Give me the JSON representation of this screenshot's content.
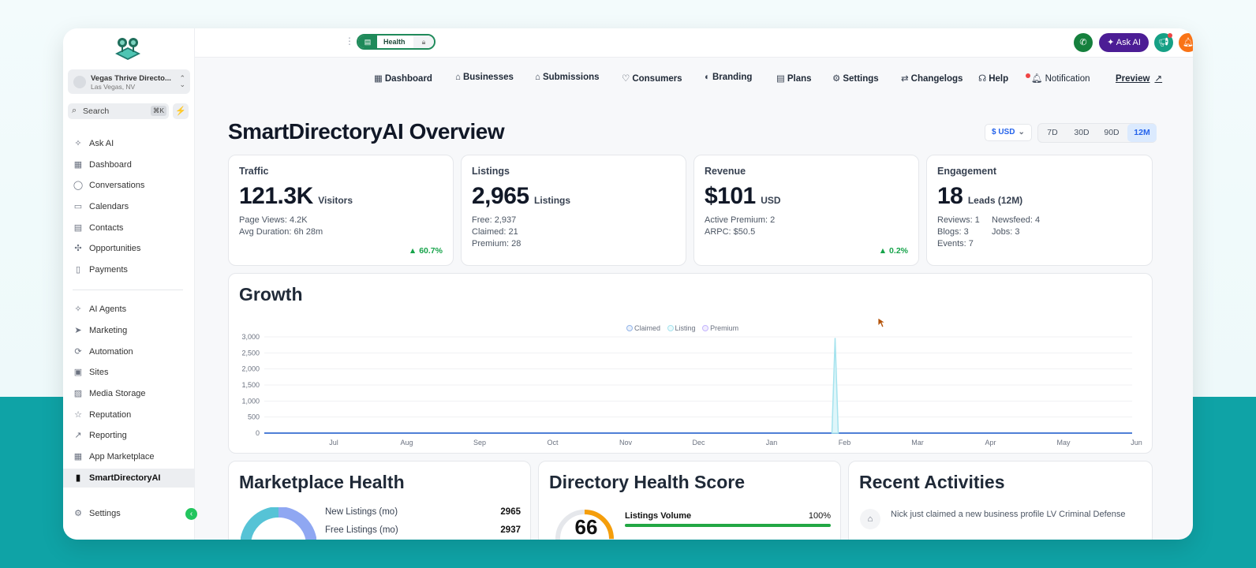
{
  "sidebar": {
    "location": {
      "name": "Vegas Thrive Directo...",
      "city": "Las Vegas, NV"
    },
    "search": {
      "label": "Search",
      "shortcut": "⌘K"
    },
    "items": [
      {
        "label": "Ask AI",
        "icon": "sparkle-icon"
      },
      {
        "label": "Dashboard",
        "icon": "grid-icon"
      },
      {
        "label": "Conversations",
        "icon": "chat-icon"
      },
      {
        "label": "Calendars",
        "icon": "calendar-icon"
      },
      {
        "label": "Contacts",
        "icon": "contacts-icon"
      },
      {
        "label": "Opportunities",
        "icon": "opportunities-icon"
      },
      {
        "label": "Payments",
        "icon": "receipt-icon"
      },
      {
        "label": "AI Agents",
        "icon": "sparkle-icon"
      },
      {
        "label": "Marketing",
        "icon": "send-icon"
      },
      {
        "label": "Automation",
        "icon": "automation-icon"
      },
      {
        "label": "Sites",
        "icon": "sites-icon"
      },
      {
        "label": "Media Storage",
        "icon": "image-icon"
      },
      {
        "label": "Reputation",
        "icon": "star-icon"
      },
      {
        "label": "Reporting",
        "icon": "trend-icon"
      },
      {
        "label": "App Marketplace",
        "icon": "apps-icon"
      },
      {
        "label": "SmartDirectoryAI",
        "icon": "book-icon"
      },
      {
        "label": "Settings",
        "icon": "gear-icon"
      }
    ]
  },
  "topbar": {
    "health_label": "Health",
    "ask_ai_label": "Ask AI",
    "help_glyph": "?",
    "avatar_initials": "TG"
  },
  "nav": {
    "links": [
      "Dashboard",
      "Businesses",
      "Submissions",
      "Consumers",
      "Branding",
      "Plans",
      "Settings",
      "Changelogs",
      "Help",
      "Notification",
      "Preview"
    ]
  },
  "header": {
    "title": "SmartDirectoryAI Overview",
    "currency": "$ USD",
    "ranges": [
      "7D",
      "30D",
      "90D",
      "12M"
    ],
    "active_range": "12M"
  },
  "stats": {
    "traffic": {
      "title": "Traffic",
      "value": "121.3K",
      "unit": "Visitors",
      "lines": [
        "Page Views: 4.2K",
        "Avg Duration: 6h 28m"
      ],
      "delta": "▲ 60.7%"
    },
    "listings": {
      "title": "Listings",
      "value": "2,965",
      "unit": "Listings",
      "lines": [
        "Free: 2,937",
        "Claimed: 21",
        "Premium: 28"
      ]
    },
    "revenue": {
      "title": "Revenue",
      "value": "$101",
      "unit": "USD",
      "lines": [
        "Active Premium: 2",
        "ARPC: $50.5"
      ],
      "delta": "▲ 0.2%"
    },
    "engagement": {
      "title": "Engagement",
      "value": "18",
      "unit": "Leads (12M)",
      "col1": [
        "Reviews: 1",
        "Blogs: 3",
        "Events: 7"
      ],
      "col2": [
        "Newsfeed: 4",
        "Jobs: 3"
      ]
    }
  },
  "growth": {
    "title": "Growth"
  },
  "chart_data": {
    "type": "line",
    "x": [
      "Jul",
      "Aug",
      "Sep",
      "Oct",
      "Nov",
      "Dec",
      "Jan",
      "Feb",
      "Mar",
      "Apr",
      "May",
      "Jun"
    ],
    "ylim": [
      0,
      3000
    ],
    "yticks": [
      "3,000",
      "2,500",
      "2,000",
      "1,500",
      "1,000",
      "500",
      "0"
    ],
    "legend_position": "top-center",
    "series": [
      {
        "name": "Claimed",
        "color": "#93b4e8",
        "spike": null
      },
      {
        "name": "Listing",
        "color": "#a5e3ee",
        "spike": {
          "at": "Feb",
          "value": 2965
        }
      },
      {
        "name": "Premium",
        "color": "#c4b5fd",
        "spike": null
      }
    ],
    "baseline_color": "#4f7fd6"
  },
  "marketplace": {
    "title": "Marketplace Health",
    "rows": [
      {
        "label": "New Listings (mo)",
        "value": "2965"
      },
      {
        "label": "Free Listings (mo)",
        "value": "2937"
      }
    ]
  },
  "directory_health": {
    "title": "Directory Health Score",
    "score": "66",
    "metric_label": "Listings Volume",
    "metric_value": "100%",
    "metric_fraction": 1.0
  },
  "recent": {
    "title": "Recent Activities",
    "items": [
      "Nick just claimed a new business profile LV Criminal Defense"
    ]
  },
  "colors": {
    "accent": "#2563eb",
    "positive": "#16a34a",
    "brand_purple": "#4c1d95",
    "teal_bg": "#0fa3a6"
  }
}
